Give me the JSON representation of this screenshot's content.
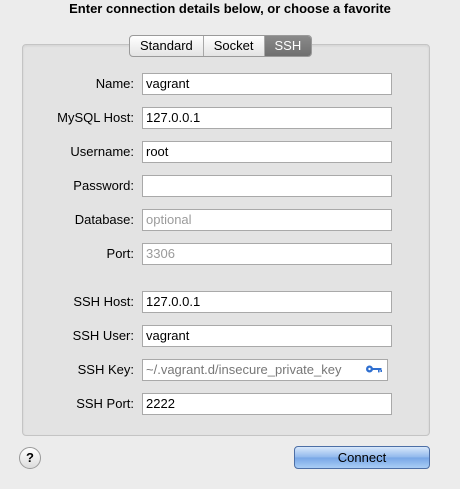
{
  "header": {
    "title": "Enter connection details below, or choose a favorite"
  },
  "tabs": [
    {
      "label": "Standard",
      "active": false
    },
    {
      "label": "Socket",
      "active": false
    },
    {
      "label": "SSH",
      "active": true
    }
  ],
  "form": {
    "name": {
      "label": "Name:",
      "value": "vagrant"
    },
    "mysql_host": {
      "label": "MySQL Host:",
      "value": "127.0.0.1"
    },
    "username": {
      "label": "Username:",
      "value": "root"
    },
    "password": {
      "label": "Password:",
      "value": ""
    },
    "database": {
      "label": "Database:",
      "placeholder": "optional"
    },
    "port": {
      "label": "Port:",
      "placeholder": "3306"
    },
    "ssh_host": {
      "label": "SSH Host:",
      "value": "127.0.0.1"
    },
    "ssh_user": {
      "label": "SSH User:",
      "value": "vagrant"
    },
    "ssh_key": {
      "label": "SSH Key:",
      "value": "~/.vagrant.d/insecure_private_key",
      "button_icon": "key-icon"
    },
    "ssh_port": {
      "label": "SSH Port:",
      "value": "2222"
    }
  },
  "footer": {
    "help_label": "?",
    "connect_label": "Connect"
  },
  "colors": {
    "window_bg": "#ececec",
    "panel_bg": "#e3e3e3",
    "connect_button": "#8fb7ec",
    "key_icon": "#2f6fd0"
  }
}
